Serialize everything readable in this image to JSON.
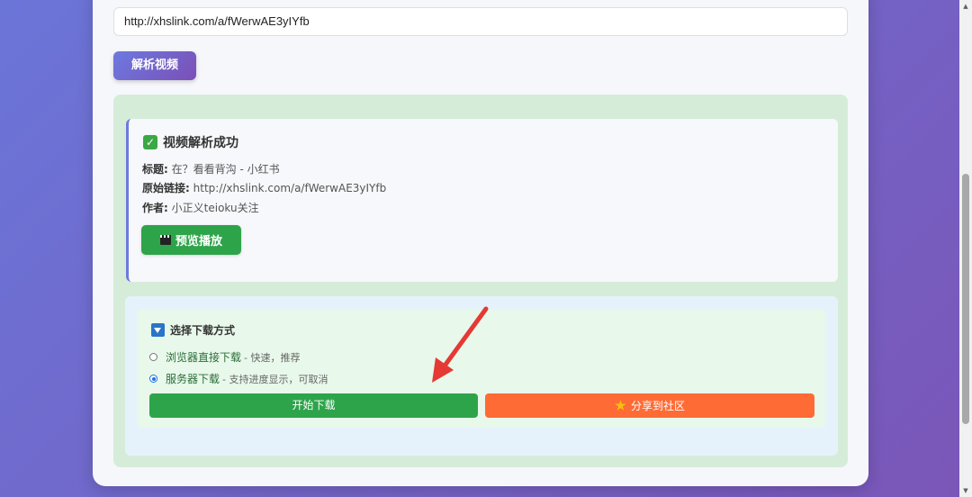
{
  "url_input": {
    "value": "http://xhslink.com/a/fWerwAE3yIYfb"
  },
  "parse_button": {
    "label": "解析视频"
  },
  "result": {
    "title": "视频解析成功",
    "title_label": "标题:",
    "title_value": "在？看看背沟 - 小红书",
    "link_label": "原始链接:",
    "link_value": "http://xhslink.com/a/fWerwAE3yIYfb",
    "author_label": "作者:",
    "author_value": "小正义teioku关注",
    "preview_label": "预览播放"
  },
  "download": {
    "title": "选择下载方式",
    "options": [
      {
        "label": "浏览器直接下载",
        "desc": "- 快速，推荐",
        "selected": false
      },
      {
        "label": "服务器下载",
        "desc": "- 支持进度显示，可取消",
        "selected": true
      }
    ],
    "start_label": "开始下载",
    "share_label": "分享到社区"
  },
  "colors": {
    "accent": "#6c7ae0",
    "success": "#2ea44a",
    "share": "#ff6b35",
    "annotation": "#e53935"
  },
  "icons": {
    "success": "check-icon",
    "preview": "clapper-icon",
    "download_title": "down-triangle-icon",
    "share": "sparkle-icon"
  }
}
